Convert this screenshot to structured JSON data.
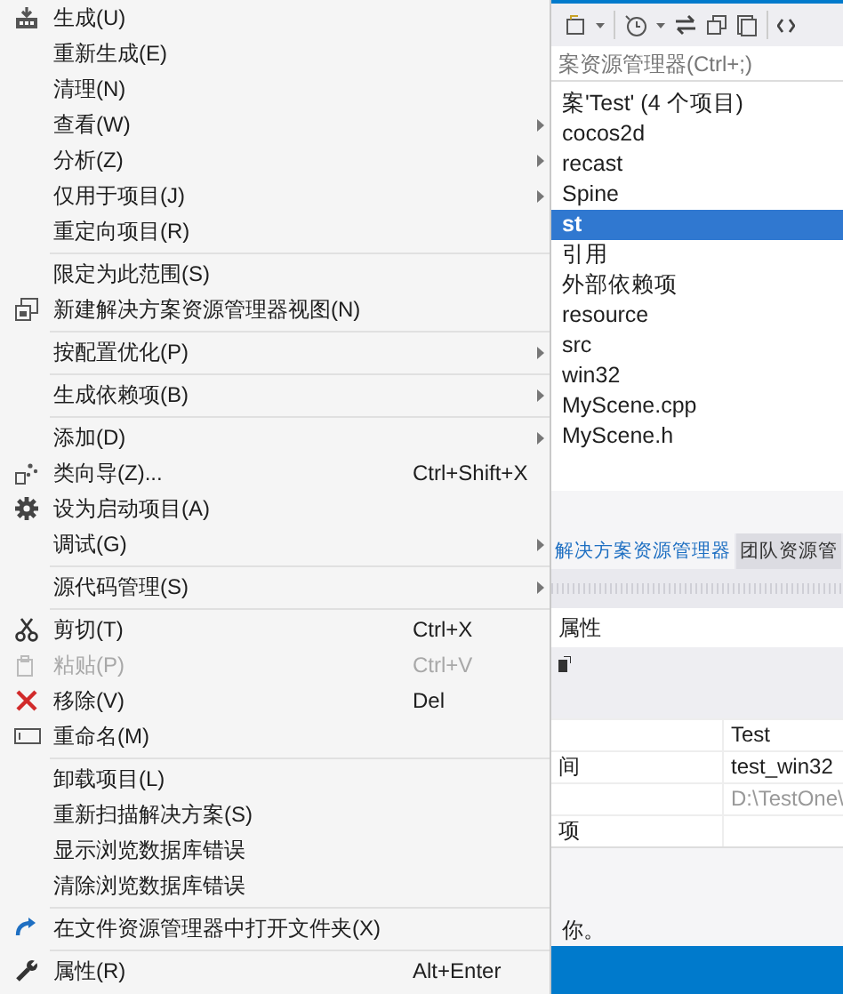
{
  "context_menu": {
    "items": [
      {
        "kind": "item",
        "label": "生成(U)"
      },
      {
        "kind": "item",
        "label": "重新生成(E)"
      },
      {
        "kind": "item",
        "label": "清理(N)"
      },
      {
        "kind": "item",
        "label": "查看(W)",
        "submenu": true
      },
      {
        "kind": "item",
        "label": "分析(Z)",
        "submenu": true
      },
      {
        "kind": "item",
        "label": "仅用于项目(J)",
        "submenu": true
      },
      {
        "kind": "item",
        "label": "重定向项目(R)"
      },
      {
        "kind": "separator"
      },
      {
        "kind": "item",
        "label": "限定为此范围(S)"
      },
      {
        "kind": "item",
        "label": "新建解决方案资源管理器视图(N)"
      },
      {
        "kind": "separator"
      },
      {
        "kind": "item",
        "label": "按配置优化(P)",
        "submenu": true
      },
      {
        "kind": "separator"
      },
      {
        "kind": "item",
        "label": "生成依赖项(B)",
        "submenu": true
      },
      {
        "kind": "separator"
      },
      {
        "kind": "item",
        "label": "添加(D)",
        "submenu": true
      },
      {
        "kind": "item",
        "label": "类向导(Z)...",
        "shortcut": "Ctrl+Shift+X"
      },
      {
        "kind": "item",
        "label": "设为启动项目(A)"
      },
      {
        "kind": "item",
        "label": "调试(G)",
        "submenu": true
      },
      {
        "kind": "separator"
      },
      {
        "kind": "item",
        "label": "源代码管理(S)",
        "submenu": true
      },
      {
        "kind": "separator"
      },
      {
        "kind": "item",
        "label": "剪切(T)",
        "shortcut": "Ctrl+X"
      },
      {
        "kind": "item",
        "label": "粘贴(P)",
        "shortcut": "Ctrl+V",
        "disabled": true
      },
      {
        "kind": "item",
        "label": "移除(V)",
        "shortcut": "Del"
      },
      {
        "kind": "item",
        "label": "重命名(M)"
      },
      {
        "kind": "separator"
      },
      {
        "kind": "item",
        "label": "卸载项目(L)"
      },
      {
        "kind": "item",
        "label": "重新扫描解决方案(S)"
      },
      {
        "kind": "item",
        "label": "显示浏览数据库错误"
      },
      {
        "kind": "item",
        "label": "清除浏览数据库错误"
      },
      {
        "kind": "separator"
      },
      {
        "kind": "item",
        "label": "在文件资源管理器中打开文件夹(X)"
      },
      {
        "kind": "separator"
      },
      {
        "kind": "item",
        "label": "属性(R)",
        "shortcut": "Alt+Enter"
      }
    ]
  },
  "solution_explorer": {
    "search": {
      "placeholder": "案资源管理器(Ctrl+;)"
    },
    "tree": [
      {
        "label": "案'Test' (4 个项目)",
        "selected": false
      },
      {
        "label": "cocos2d",
        "selected": false
      },
      {
        "label": "recast",
        "selected": false
      },
      {
        "label": "Spine",
        "selected": false
      },
      {
        "label": "st",
        "selected": true
      },
      {
        "label": "引用",
        "selected": false
      },
      {
        "label": "外部依赖项",
        "selected": false
      },
      {
        "label": "resource",
        "selected": false
      },
      {
        "label": "src",
        "selected": false
      },
      {
        "label": "win32",
        "selected": false
      },
      {
        "label": "MyScene.cpp",
        "selected": false
      },
      {
        "label": "MyScene.h",
        "selected": false
      }
    ],
    "tabs": [
      {
        "label": "解决方案资源管理器",
        "selected": true
      },
      {
        "label": "团队资源管",
        "selected": false
      }
    ]
  },
  "properties": {
    "title": "属性",
    "rows": [
      {
        "value": "Test"
      },
      {
        "name": "间",
        "value": "test_win32"
      },
      {
        "value": "D:\\TestOne\\",
        "disabled": true
      },
      {
        "name": "项"
      }
    ],
    "description": "你。"
  }
}
